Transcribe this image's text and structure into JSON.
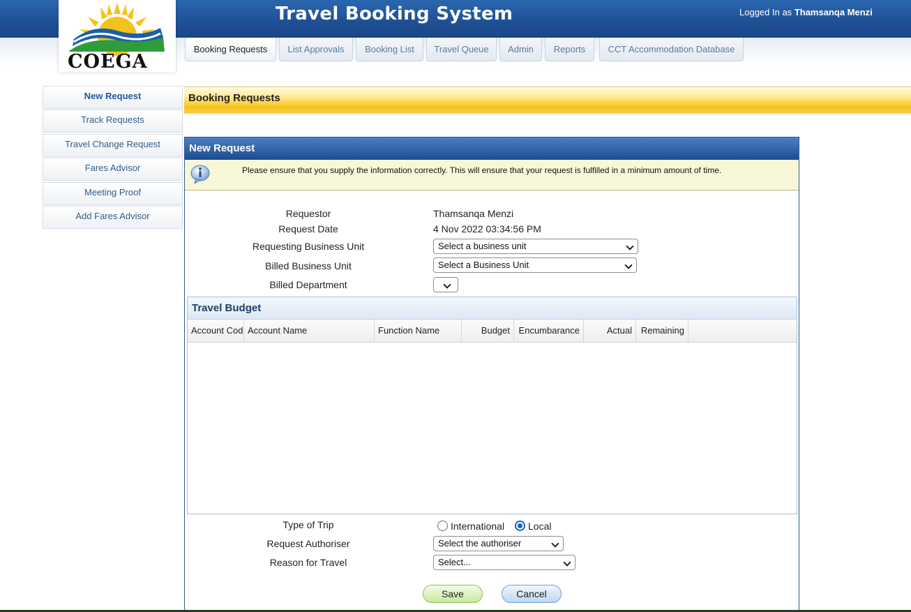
{
  "header": {
    "title": "Travel Booking System",
    "logged_in_prefix": "Logged In as",
    "user_name": "Thamsanqa Menzi",
    "logo_text": "COEGA"
  },
  "tabs": [
    {
      "label": "Booking Requests",
      "active": true
    },
    {
      "label": "List Approvals"
    },
    {
      "label": "Booking List"
    },
    {
      "label": "Travel Queue"
    },
    {
      "label": "Admin"
    },
    {
      "label": "Reports"
    },
    {
      "label": "CCT Accommodation Database"
    }
  ],
  "sidebar": {
    "items": [
      {
        "label": "New Request",
        "active": true
      },
      {
        "label": "Track Requests"
      },
      {
        "label": "Travel Change Request"
      },
      {
        "label": "Fares Advisor"
      },
      {
        "label": "Meeting Proof"
      },
      {
        "label": "Add Fares Advisor"
      }
    ]
  },
  "page": {
    "title": "Booking Requests"
  },
  "panel": {
    "title": "New Request",
    "info": "Please ensure that you supply the information correctly. This will ensure that your request is fulfilled in a minimum amount of time."
  },
  "form": {
    "requestor_label": "Requestor",
    "requestor_value": "Thamsanqa Menzi",
    "request_date_label": "Request Date",
    "request_date_value": "4 Nov 2022 03:34:56 PM",
    "requesting_bu_label": "Requesting Business Unit",
    "requesting_bu_value": "Select a business unit",
    "billed_bu_label": "Billed Business Unit",
    "billed_bu_value": "Select a Business Unit",
    "billed_dept_label": "Billed Department",
    "billed_dept_value": "",
    "trip_type_label": "Type of Trip",
    "trip_international": "International",
    "trip_local": "Local",
    "trip_selected": "Local",
    "authoriser_label": "Request Authoriser",
    "authoriser_value": "Select the authoriser",
    "reason_label": "Reason for Travel",
    "reason_value": "Select..."
  },
  "budget": {
    "title": "Travel Budget",
    "columns": [
      "Account Code",
      "Account Name",
      "Function Name",
      "Budget",
      "Encumbarance",
      "Actual",
      "Remaining"
    ]
  },
  "buttons": {
    "save": "Save",
    "cancel": "Cancel"
  },
  "colors": {
    "header_blue": "#1f4f93",
    "title_yellow": "#f6c21a",
    "link_blue": "#2f5d8a"
  }
}
